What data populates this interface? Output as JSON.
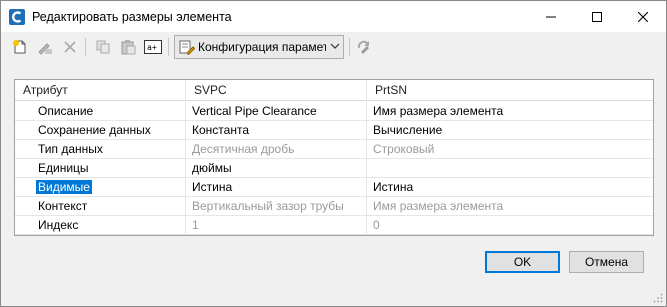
{
  "window": {
    "title": "Редактировать размеры элемента"
  },
  "toolbar": {
    "config_label": "Конфигурация параметров"
  },
  "grid": {
    "headers": [
      "Атрибут",
      "SVPC",
      "PrtSN"
    ],
    "rows": [
      {
        "attr": "Описание",
        "svpc": "Vertical Pipe Clearance",
        "prtsn": "Имя размера элемента",
        "disabled": false
      },
      {
        "attr": "Сохранение данных",
        "svpc": "Константа",
        "prtsn": "Вычисление",
        "disabled": false
      },
      {
        "attr": "Тип данных",
        "svpc": "Десятичная дробь",
        "prtsn": "Строковый",
        "disabled": true
      },
      {
        "attr": "Единицы",
        "svpc": "дюймы",
        "prtsn": "",
        "disabled": false
      },
      {
        "attr": "Видимые",
        "svpc": "Истина",
        "prtsn": "Истина",
        "disabled": false,
        "selected": true
      },
      {
        "attr": "Контекст",
        "svpc": "Вертикальный зазор трубы",
        "prtsn": "Имя размера элемента",
        "disabled": true
      },
      {
        "attr": "Индекс",
        "svpc": "1",
        "prtsn": "0",
        "disabled": true
      }
    ]
  },
  "buttons": {
    "ok": "OK",
    "cancel": "Отмена"
  },
  "colors": {
    "accent": "#0078d7",
    "disabled_text": "#9a9a9a"
  }
}
